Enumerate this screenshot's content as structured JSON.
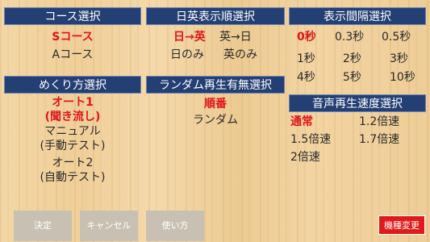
{
  "course": {
    "title": "コース選択",
    "options": [
      "Sコース",
      "Aコース"
    ]
  },
  "order": {
    "title": "日英表示順選択",
    "options": [
      "日→英",
      "英→日",
      "日のみ",
      "英のみ"
    ]
  },
  "interval": {
    "title": "表示間隔選択",
    "options": [
      "0秒",
      "0.3秒",
      "0.5秒",
      "1秒",
      "2秒",
      "3秒",
      "4秒",
      "5秒",
      "10秒"
    ]
  },
  "mekuri": {
    "title": "めくり方選択",
    "options": [
      {
        "line1": "オート1",
        "line2": "(聞き流し)"
      },
      {
        "line1": "マニュアル",
        "line2": "(手動テスト)"
      },
      {
        "line1": "オート2",
        "line2": "(自動テスト)"
      }
    ]
  },
  "random": {
    "title": "ランダム再生有無選択",
    "options": [
      "順番",
      "ランダム"
    ]
  },
  "speed": {
    "title": "音声再生速度選択",
    "options": [
      "通常",
      "1.2倍速",
      "1.5倍速",
      "1.7倍速",
      "2倍速"
    ]
  },
  "footer": {
    "ok": "決定",
    "cancel": "キャンセル",
    "howto": "使い方",
    "change_device": "機種変更"
  },
  "colors": {
    "header_bg": "#243f73",
    "selected": "#e0141b",
    "button_bg": "#c8c1b3",
    "device_button": "#e01a1a"
  }
}
